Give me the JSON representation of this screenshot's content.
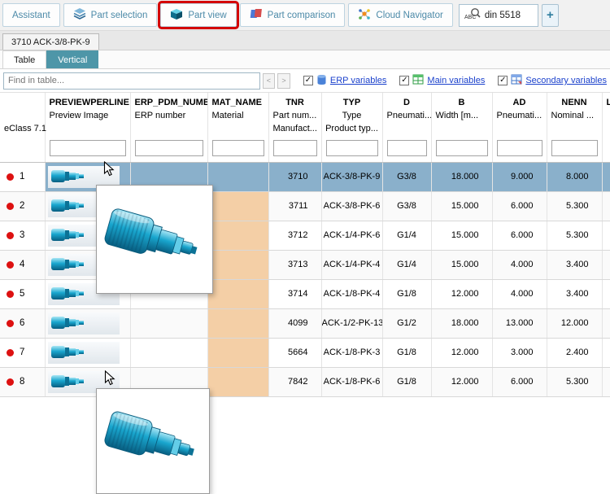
{
  "toolbar": {
    "tabs": [
      {
        "label": "Assistant"
      },
      {
        "label": "Part selection"
      },
      {
        "label": "Part view"
      },
      {
        "label": "Part comparison"
      },
      {
        "label": "Cloud Navigator"
      }
    ],
    "search_value": "din 5518",
    "add_button_label": "+"
  },
  "part_tab_label": "3710 ACK-3/8-PK-9",
  "view_tabs": {
    "table_label": "Table",
    "vertical_label": "Vertical"
  },
  "find_bar": {
    "placeholder": "Find in table...",
    "prev": "<",
    "next": ">",
    "erp_label": "ERP variables",
    "main_label": "Main variables",
    "secondary_label": "Secondary variables"
  },
  "table": {
    "eclass_label": "eClass 7.1",
    "columns": [
      {
        "key": "preview",
        "name": "PREVIEWPERLINE",
        "desc": "Preview Image",
        "desc2": ""
      },
      {
        "key": "erp",
        "name": "ERP_PDM_NUMBER",
        "desc": "ERP number",
        "desc2": ""
      },
      {
        "key": "mat",
        "name": "MAT_NAME",
        "desc": "Material",
        "desc2": ""
      },
      {
        "key": "tnr",
        "name": "TNR",
        "desc": "Part num...",
        "desc2": "Manufact..."
      },
      {
        "key": "typ",
        "name": "TYP",
        "desc": "Type",
        "desc2": "Product typ..."
      },
      {
        "key": "d",
        "name": "D",
        "desc": "Pneumati...",
        "desc2": ""
      },
      {
        "key": "b",
        "name": "B",
        "desc": "Width [m...",
        "desc2": ""
      },
      {
        "key": "ad",
        "name": "AD",
        "desc": "Pneumati...",
        "desc2": ""
      },
      {
        "key": "nenn",
        "name": "NENN",
        "desc": "Nominal ...",
        "desc2": ""
      },
      {
        "key": "l",
        "name": "L",
        "desc": "",
        "desc2": ""
      }
    ],
    "rows": [
      {
        "num": "1",
        "tnr": "3710",
        "typ": "ACK-3/8-PK-9",
        "d": "G3/8",
        "b": "18.000",
        "ad": "9.000",
        "nenn": "8.000",
        "selected": true
      },
      {
        "num": "2",
        "tnr": "3711",
        "typ": "ACK-3/8-PK-6",
        "d": "G3/8",
        "b": "15.000",
        "ad": "6.000",
        "nenn": "5.300",
        "selected": false
      },
      {
        "num": "3",
        "tnr": "3712",
        "typ": "ACK-1/4-PK-6",
        "d": "G1/4",
        "b": "15.000",
        "ad": "6.000",
        "nenn": "5.300",
        "selected": false
      },
      {
        "num": "4",
        "tnr": "3713",
        "typ": "ACK-1/4-PK-4",
        "d": "G1/4",
        "b": "15.000",
        "ad": "4.000",
        "nenn": "3.400",
        "selected": false
      },
      {
        "num": "5",
        "tnr": "3714",
        "typ": "ACK-1/8-PK-4",
        "d": "G1/8",
        "b": "12.000",
        "ad": "4.000",
        "nenn": "3.400",
        "selected": false
      },
      {
        "num": "6",
        "tnr": "4099",
        "typ": "ACK-1/2-PK-13",
        "d": "G1/2",
        "b": "18.000",
        "ad": "13.000",
        "nenn": "12.000",
        "selected": false
      },
      {
        "num": "7",
        "tnr": "5664",
        "typ": "ACK-1/8-PK-3",
        "d": "G1/8",
        "b": "12.000",
        "ad": "3.000",
        "nenn": "2.400",
        "selected": false
      },
      {
        "num": "8",
        "tnr": "7842",
        "typ": "ACK-1/8-PK-6",
        "d": "G1/8",
        "b": "12.000",
        "ad": "6.000",
        "nenn": "5.300",
        "selected": false
      }
    ]
  },
  "colors": {
    "accent_teal": "#4e96a8",
    "selected_row": "#8ab0cb",
    "material_column": "#f4cfa6",
    "annotation_red": "#d40000",
    "link_blue": "#1b41cc",
    "status_dot_red": "#dd1111",
    "part_blue": "#18a8cf"
  }
}
